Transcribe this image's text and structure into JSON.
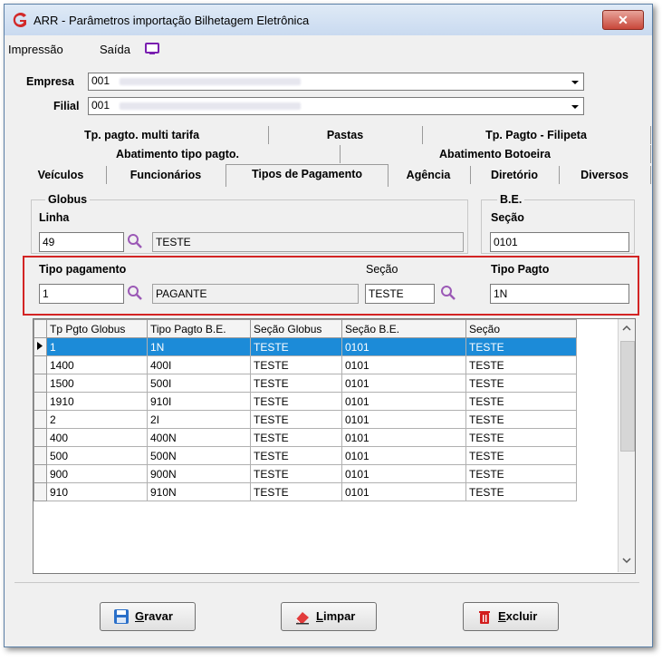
{
  "window": {
    "title": "ARR - Parâmetros importação Bilhetagem Eletrônica",
    "close": "✕"
  },
  "menu": {
    "impressao": "Impressão",
    "saida": "Saída"
  },
  "empresa": {
    "label": "Empresa",
    "value": "001"
  },
  "filial": {
    "label": "Filial",
    "value": "001"
  },
  "tabs": {
    "row1": [
      "Tp. pagto. multi tarifa",
      "Pastas",
      "Tp. Pagto - Filipeta"
    ],
    "row2": [
      "Abatimento tipo pagto.",
      "Abatimento Botoeira"
    ],
    "row3": [
      "Veículos",
      "Funcionários",
      "Tipos de Pagamento",
      "Agência",
      "Diretório",
      "Diversos"
    ],
    "active": "Tipos de Pagamento"
  },
  "globus": {
    "legend": "Globus",
    "linha_label": "Linha",
    "linha_value": "49",
    "linha_desc": "TESTE",
    "tipo_label": "Tipo pagamento",
    "tipo_value": "1",
    "tipo_desc": "PAGANTE",
    "secao_label": "Seção",
    "secao_value": "TESTE"
  },
  "be": {
    "legend": "B.E.",
    "secao_label": "Seção",
    "secao_value": "0101",
    "tipo_label": "Tipo Pagto",
    "tipo_value": "1N"
  },
  "grid": {
    "columns": [
      "Tp Pgto Globus",
      "Tipo Pagto B.E.",
      "Seção Globus",
      "Seção B.E.",
      "Seção"
    ],
    "rows": [
      [
        "1",
        "1N",
        "TESTE",
        "0101",
        "TESTE"
      ],
      [
        "1400",
        "400I",
        "TESTE",
        "0101",
        "TESTE"
      ],
      [
        "1500",
        "500I",
        "TESTE",
        "0101",
        "TESTE"
      ],
      [
        "1910",
        "910I",
        "TESTE",
        "0101",
        "TESTE"
      ],
      [
        "2",
        "2I",
        "TESTE",
        "0101",
        "TESTE"
      ],
      [
        "400",
        "400N",
        "TESTE",
        "0101",
        "TESTE"
      ],
      [
        "500",
        "500N",
        "TESTE",
        "0101",
        "TESTE"
      ],
      [
        "900",
        "900N",
        "TESTE",
        "0101",
        "TESTE"
      ],
      [
        "910",
        "910N",
        "TESTE",
        "0101",
        "TESTE"
      ]
    ],
    "selected_row": 0
  },
  "buttons": {
    "gravar": "Gravar",
    "limpar": "Limpar",
    "excluir": "Excluir"
  },
  "colors": {
    "selection": "#1c8bd8",
    "highlight": "#d32424",
    "search_icon": "#9b59b6"
  },
  "icons": [
    "app-logo",
    "monitor-icon",
    "search-icon",
    "save-icon",
    "eraser-icon",
    "trash-icon"
  ]
}
